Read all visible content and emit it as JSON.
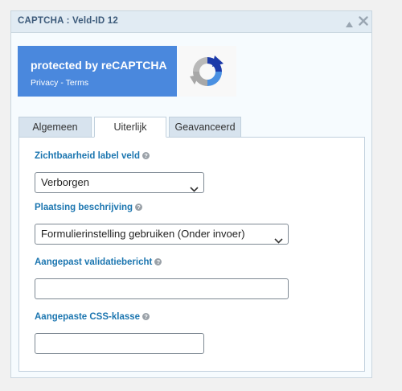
{
  "panel": {
    "title": "CAPTCHA : Veld-ID 12",
    "icons": {
      "collapse": "triangle-up-icon",
      "close": "close-icon"
    }
  },
  "recaptcha": {
    "protected_text": "protected by reCAPTCHA",
    "privacy_label": "Privacy",
    "separator": " - ",
    "terms_label": "Terms",
    "logo_icon": "recaptcha-logo-icon",
    "bg_color": "#4a88dd"
  },
  "tabs": [
    {
      "label": "Algemeen",
      "active": false
    },
    {
      "label": "Uiterlijk",
      "active": true
    },
    {
      "label": "Geavanceerd",
      "active": false
    }
  ],
  "fields": {
    "label_visibility": {
      "label": "Zichtbaarheid label veld",
      "value": "Verborgen"
    },
    "description_placement": {
      "label": "Plaatsing beschrijving",
      "value": "Formulierinstelling gebruiken (Onder invoer)"
    },
    "validation_message": {
      "label": "Aangepast validatiebericht",
      "value": ""
    },
    "css_class": {
      "label": "Aangepaste CSS-klasse",
      "value": ""
    }
  },
  "colors": {
    "label": "#1c76b0",
    "header_bg": "#e1ebf3"
  }
}
